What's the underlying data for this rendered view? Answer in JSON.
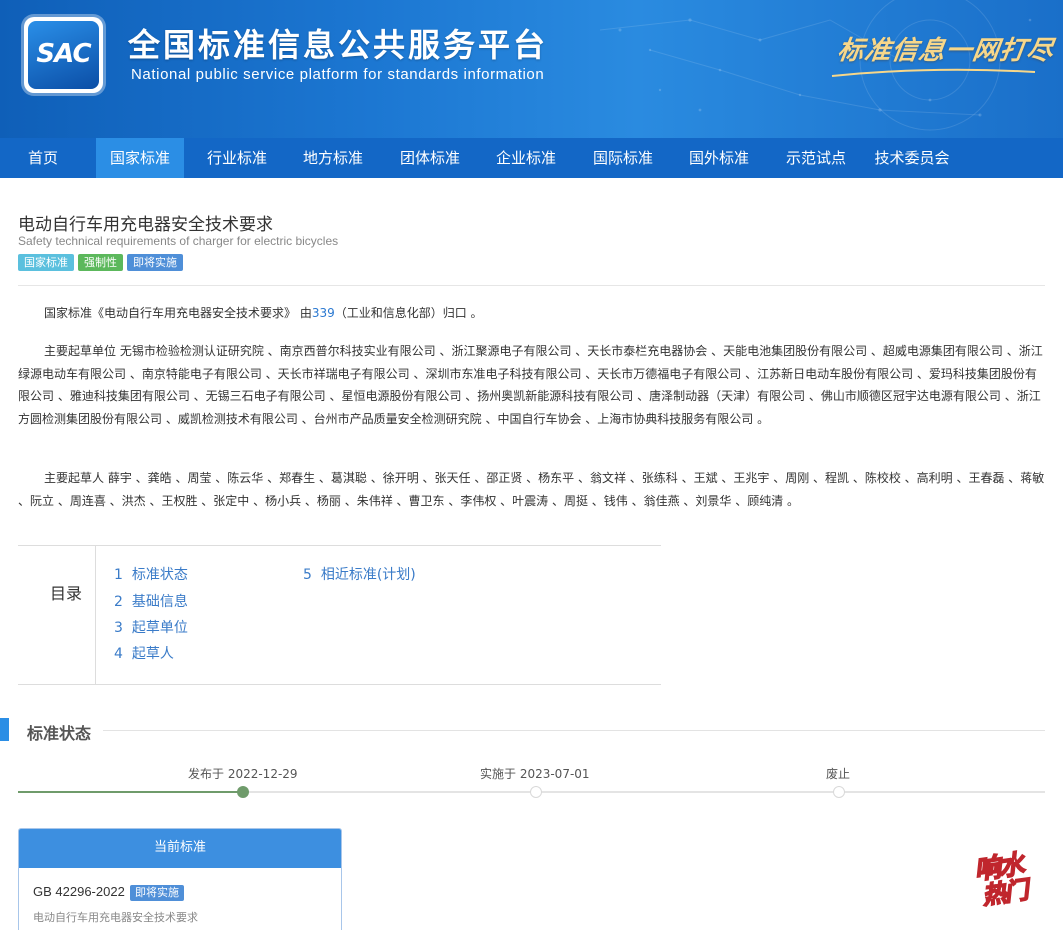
{
  "header": {
    "logo_text": "SAC",
    "title": "全国标准信息公共服务平台",
    "subtitle": "National public service platform  for standards information",
    "slogan": "标准信息一网打尽"
  },
  "nav": {
    "items": [
      {
        "label": "首页"
      },
      {
        "label": "国家标准",
        "active": true
      },
      {
        "label": "行业标准"
      },
      {
        "label": "地方标准"
      },
      {
        "label": "团体标准"
      },
      {
        "label": "企业标准"
      },
      {
        "label": "国际标准"
      },
      {
        "label": "国外标准"
      },
      {
        "label": "示范试点"
      },
      {
        "label": "技术委员会"
      }
    ]
  },
  "standard": {
    "title_cn": "电动自行车用充电器安全技术要求",
    "title_en": "Safety technical requirements of charger for electric bicycles",
    "badges": [
      "国家标准",
      "强制性",
      "即将实施"
    ]
  },
  "intro": {
    "prefix": "国家标准《电动自行车用充电器安全技术要求》 由",
    "tc_number": "339",
    "suffix": "（工业和信息化部）归口 。"
  },
  "drafting_units": {
    "label": "主要起草单位",
    "text": " 无锡市检验检测认证研究院 、南京西普尔科技实业有限公司 、浙江聚源电子有限公司 、天长市泰栏充电器协会 、天能电池集团股份有限公司 、超威电源集团有限公司 、浙江绿源电动车有限公司 、南京特能电子有限公司 、天长市祥瑞电子有限公司 、深圳市东准电子科技有限公司 、天长市万德福电子有限公司 、江苏新日电动车股份有限公司 、爱玛科技集团股份有限公司 、雅迪科技集团有限公司 、无锡三石电子有限公司 、星恒电源股份有限公司 、扬州奥凯新能源科技有限公司 、唐泽制动器（天津）有限公司 、佛山市顺德区冠宇达电源有限公司 、浙江方圆检测集团股份有限公司 、威凯检测技术有限公司 、台州市产品质量安全检测研究院 、中国自行车协会 、上海市协典科技服务有限公司 。"
  },
  "drafters": {
    "label": "主要起草人",
    "text": " 薛宇 、龚皓 、周莹 、陈云华 、郑春生 、葛淇聪 、徐开明 、张天任 、邵正贤 、杨东平 、翁文祥 、张练科 、王斌 、王兆宇 、周刚 、程凯 、陈校校 、高利明 、王春磊 、蒋敏 、阮立 、周连喜 、洪杰 、王权胜 、张定中 、杨小兵 、杨丽 、朱伟祥 、曹卫东 、李伟权 、叶震涛 、周挺 、钱伟 、翁佳燕 、刘景华 、顾纯清 。"
  },
  "toc": {
    "label": "目录",
    "items": [
      {
        "num": "1",
        "label": "标准状态"
      },
      {
        "num": "2",
        "label": "基础信息"
      },
      {
        "num": "3",
        "label": "起草单位"
      },
      {
        "num": "4",
        "label": "起草人"
      },
      {
        "num": "5",
        "label": "相近标准(计划)"
      }
    ]
  },
  "status_section": {
    "title": "标准状态",
    "timeline": [
      {
        "label": "发布于 2022-12-29",
        "done": true
      },
      {
        "label": "实施于 2023-07-01",
        "done": false
      },
      {
        "label": "废止",
        "done": false
      }
    ]
  },
  "current_card": {
    "header": "当前标准",
    "code": "GB 42296-2022",
    "badge": "即将实施",
    "name": "电动自行车用充电器安全技术要求"
  },
  "watermark": {
    "line1": "响水",
    "line2": "热门"
  },
  "colors": {
    "nav_bg": "#1367c6",
    "nav_active": "#2b8ee5",
    "link": "#2b79d1",
    "timeline_done": "#6f9b6b"
  }
}
